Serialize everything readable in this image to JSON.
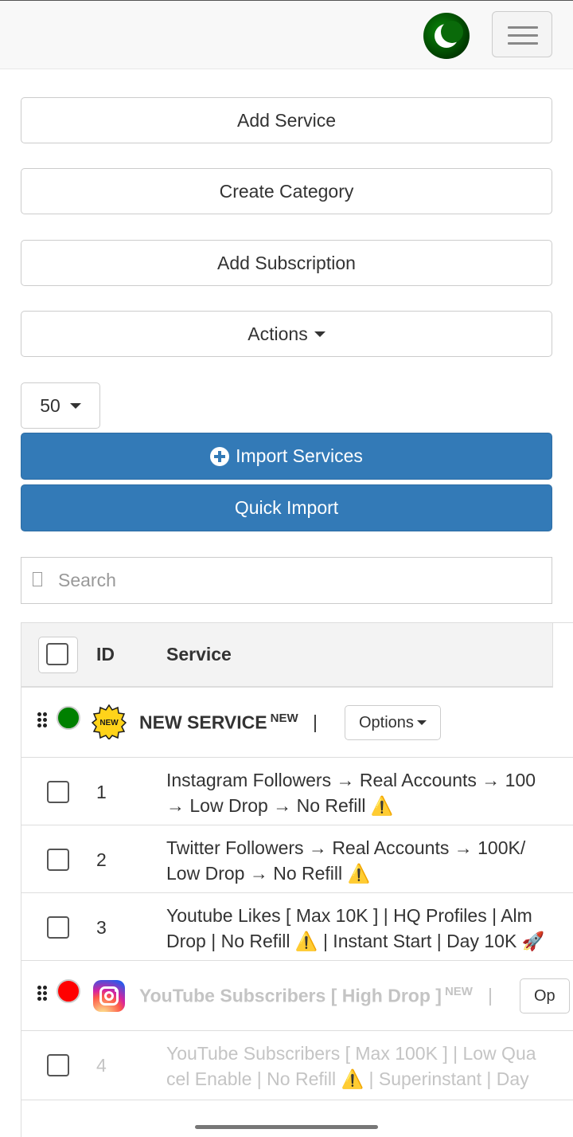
{
  "header": {
    "theme_toggle_icon": "crescent-moon-icon",
    "menu_icon": "hamburger-menu-icon"
  },
  "toolbar": {
    "add_service": "Add Service",
    "create_category": "Create Category",
    "add_subscription": "Add Subscription",
    "actions": "Actions"
  },
  "pager": {
    "per_page": "50"
  },
  "imports": {
    "import_services": "Import Services",
    "quick_import": "Quick Import"
  },
  "search": {
    "placeholder": "Search",
    "value": ""
  },
  "table": {
    "columns": [
      "ID",
      "Service"
    ],
    "categories": [
      {
        "name": "NEW SERVICE",
        "badge": "NEW",
        "separator": "|",
        "options_label": "Options",
        "status_color": "#008000",
        "icon": "new-badge-icon",
        "services": [
          {
            "id": "1",
            "line1": "Instagram Followers → Real Accounts → 100",
            "line2": "→ Low Drop → No Refill ⚠️"
          },
          {
            "id": "2",
            "line1": "Twitter Followers → Real Accounts → 100K/",
            "line2": "Low Drop → No Refill ⚠️"
          },
          {
            "id": "3",
            "line1": "Youtube Likes [ Max 10K ] | HQ Profiles | Alm",
            "line2": "Drop | No Refill ⚠️ | Instant Start | Day 10K 🚀"
          }
        ]
      },
      {
        "name": "YouTube Subscribers [ High Drop ]",
        "badge": "NEW",
        "separator": "|",
        "options_label": "Op",
        "status_color": "#ff0000",
        "icon": "instagram-icon",
        "services": [
          {
            "id": "4",
            "line1": "YouTube Subscribers [ Max 100K ] | Low Qua",
            "line2": "cel Enable | No Refill ⚠️ | Superinstant | Day"
          }
        ]
      }
    ]
  },
  "colors": {
    "primary": "#337ab7",
    "active": "#008000",
    "inactive": "#ff0000",
    "disabled_text": "#c4c4c4"
  }
}
